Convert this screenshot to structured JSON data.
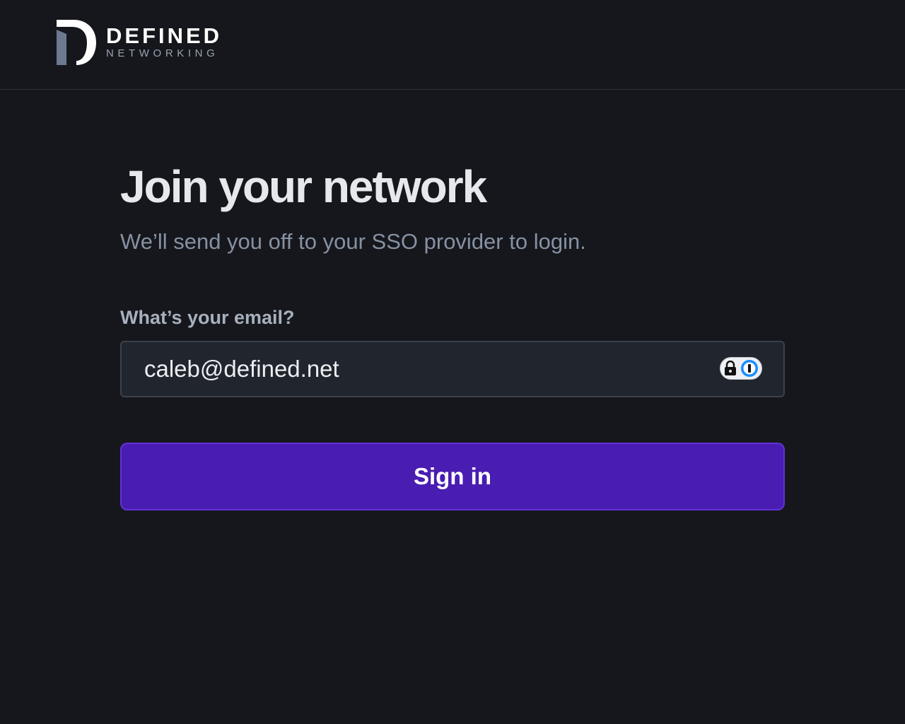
{
  "brand": {
    "name": "DEFINED",
    "tagline": "NETWORKING",
    "mark_icon": "defined-d-logo-icon"
  },
  "main": {
    "title": "Join your network",
    "subtitle": "We’ll send you off to your SSO provider to login.",
    "email_label": "What’s your email?",
    "email_value": "caleb@defined.net",
    "password_manager_icon": "1password-lock-icon",
    "sign_in_label": "Sign in"
  },
  "colors": {
    "background": "#15171c",
    "primary_button": "#491cb2",
    "input_background": "#21252d",
    "muted_text": "#8691a3"
  }
}
